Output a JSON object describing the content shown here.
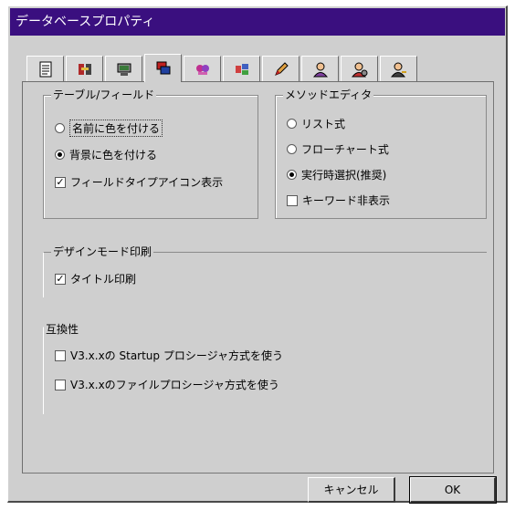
{
  "window": {
    "title": "データベースプロパティ"
  },
  "tabs": [
    {
      "name": "tab-general",
      "icon": "document-icon",
      "active": false
    },
    {
      "name": "tab-tools",
      "icon": "tools-icon",
      "active": false
    },
    {
      "name": "tab-monitor",
      "icon": "monitor-icon",
      "active": false
    },
    {
      "name": "tab-display",
      "icon": "display-icon",
      "active": true
    },
    {
      "name": "tab-colors",
      "icon": "palette-icon",
      "active": false
    },
    {
      "name": "tab-shapes",
      "icon": "shapes-icon",
      "active": false
    },
    {
      "name": "tab-edit",
      "icon": "pencil-icon",
      "active": false
    },
    {
      "name": "tab-user",
      "icon": "user-icon",
      "active": false
    },
    {
      "name": "tab-user-gear",
      "icon": "user-gear-icon",
      "active": false
    },
    {
      "name": "tab-user-key",
      "icon": "user-key-icon",
      "active": false
    }
  ],
  "table_field": {
    "legend": "テーブル/フィールド",
    "option_name_color": "名前に色を付ける",
    "option_bg_color": "背景に色を付ける",
    "option_field_type_icon": "フィールドタイプアイコン表示"
  },
  "method_editor": {
    "legend": "メソッドエディタ",
    "option_list": "リスト式",
    "option_flowchart": "フローチャート式",
    "option_runtime": "実行時選択(推奨)",
    "option_hide_keywords": "キーワード非表示"
  },
  "design_print": {
    "legend": "デザインモード印刷",
    "option_title_print": "タイトル印刷"
  },
  "compat": {
    "legend": "互換性",
    "option_startup": "V3.x.xの Startup プロシージャ方式を使う",
    "option_file_proc": "V3.x.xのファイルプロシージャ方式を使う"
  },
  "state": {
    "table_field_radio": "bg_color",
    "field_type_icon_checked": true,
    "method_editor_radio": "runtime",
    "hide_keywords_checked": false,
    "title_print_checked": true,
    "startup_checked": false,
    "file_proc_checked": false
  },
  "buttons": {
    "cancel": "キャンセル",
    "ok": "OK"
  },
  "colors": {
    "titlebar": "#3a0f7f",
    "face": "#cfcfcf"
  }
}
